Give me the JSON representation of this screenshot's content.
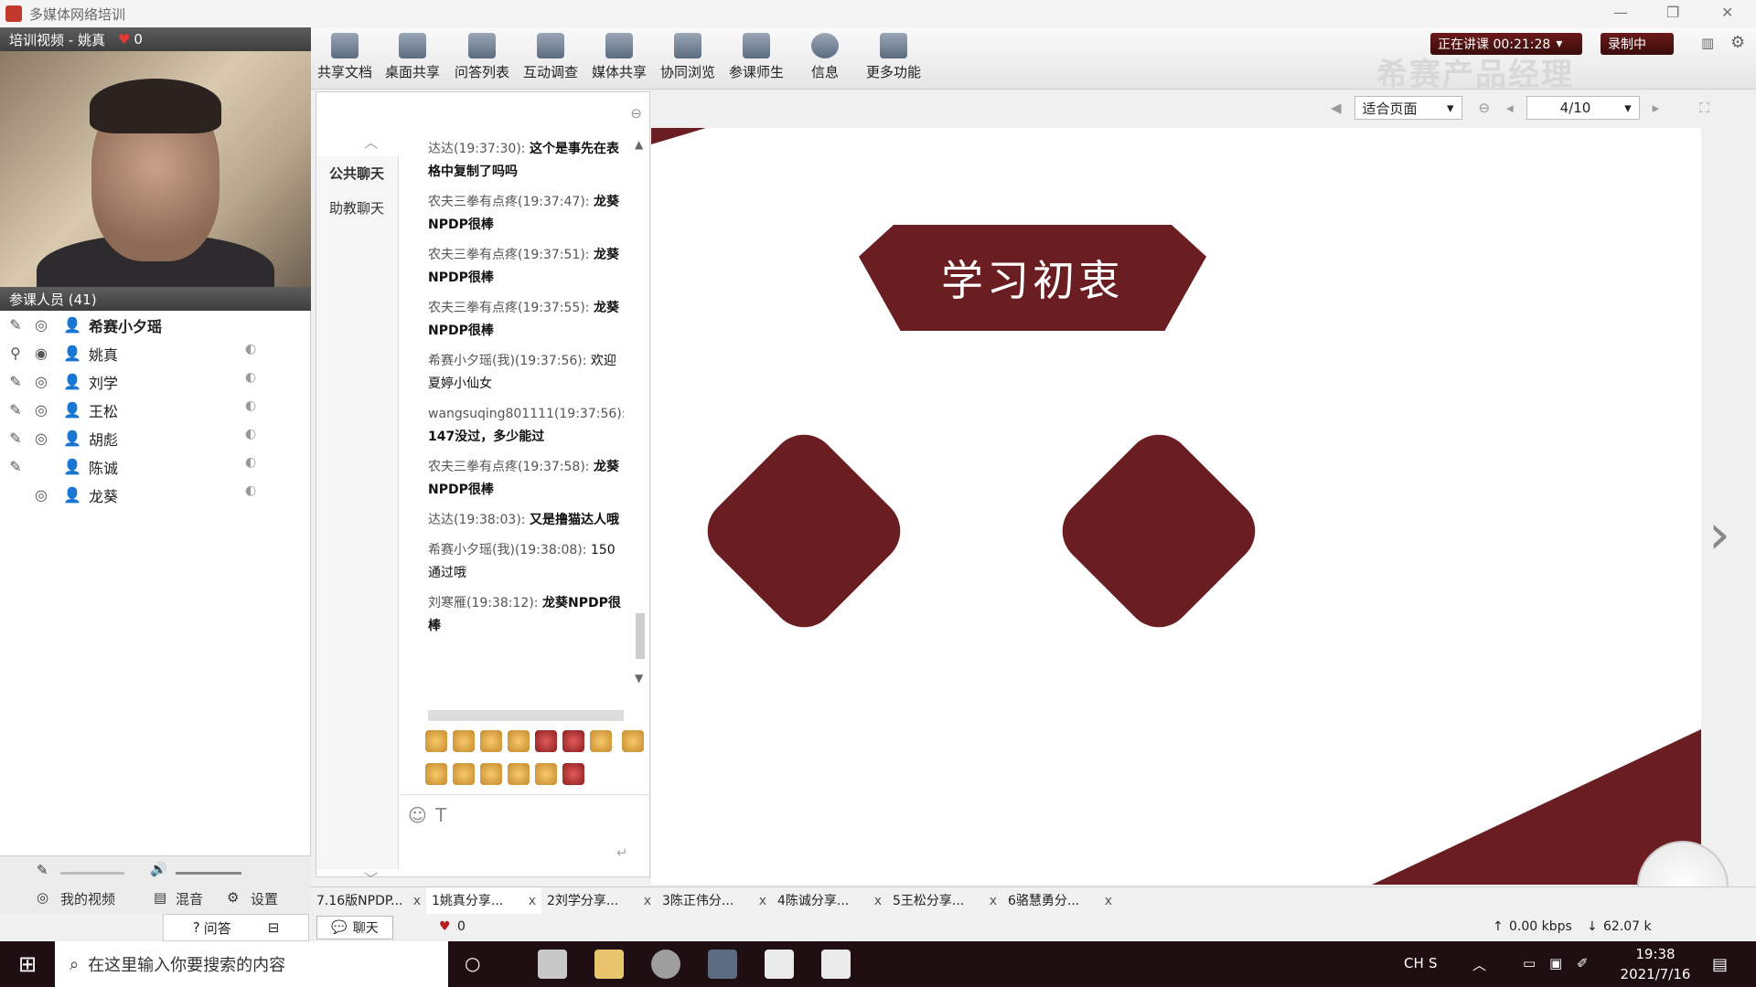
{
  "window": {
    "title": "多媒体网络培训"
  },
  "video": {
    "header": "培训视频 - 姚真",
    "likes": "0"
  },
  "members": {
    "header": "参课人员 (41)",
    "list": [
      {
        "name": "希赛小夕瑶"
      },
      {
        "name": "姚真"
      },
      {
        "name": "刘学"
      },
      {
        "name": "王松"
      },
      {
        "name": "胡彪"
      },
      {
        "name": "陈诚"
      },
      {
        "name": "龙葵"
      }
    ]
  },
  "left_bottom": {
    "my_video": "我的视频",
    "mix": "混音",
    "settings": "设置",
    "qa": "问答"
  },
  "toolbar": {
    "buttons": [
      "共享文档",
      "桌面共享",
      "问答列表",
      "互动调查",
      "媒体共享",
      "协同浏览",
      "参课师生",
      "信息",
      "更多功能"
    ],
    "live_status": "正在讲课 00:21:28",
    "record": "录制中",
    "brand_watermark": "希赛产品经理"
  },
  "docnav": {
    "fit": "适合页面",
    "page": "4/10"
  },
  "chat": {
    "tabs": [
      "公共聊天",
      "助教聊天"
    ],
    "messages": [
      {
        "who": "达达(19:37:30):",
        "text": "这个是事先在表格中复制了吗吗"
      },
      {
        "who": "农夫三拳有点疼(19:37:47):",
        "text": "龙葵NPDP很棒"
      },
      {
        "who": "农夫三拳有点疼(19:37:51):",
        "text": "龙葵NPDP很棒"
      },
      {
        "who": "农夫三拳有点疼(19:37:55):",
        "text": "龙葵NPDP很棒"
      },
      {
        "who": "希赛小夕瑶(我)(19:37:56):",
        "text": "欢迎夏婷小仙女"
      },
      {
        "who": "wangsuqing801111(19:37:56):",
        "text": "147没过，多少能过"
      },
      {
        "who": "农夫三拳有点疼(19:37:58):",
        "text": "龙葵NPDP很棒"
      },
      {
        "who": "达达(19:38:03):",
        "text": "又是撸猫达人哦"
      },
      {
        "who": "希赛小夕瑶(我)(19:38:08):",
        "text": "150通过哦"
      },
      {
        "who": "刘寒雁(19:38:12):",
        "text": "龙葵NPDP很棒"
      }
    ],
    "chat_button": "聊天",
    "likes": "0"
  },
  "slide": {
    "title": "学习初衷"
  },
  "files": [
    "7.16版NPDP...",
    "1姚真分享...",
    "2刘学分享...",
    "3陈正伟分...",
    "4陈诚分享...",
    "5王松分享...",
    "6骆慧勇分..."
  ],
  "network": {
    "up": "0.00 kbps",
    "down": "62.07 k"
  },
  "taskbar": {
    "search_placeholder": "在这里输入你要搜索的内容",
    "time": "19:38",
    "date": "2021/7/16",
    "lang": "CH"
  },
  "colors": {
    "accent": "#6b1e22",
    "taskbar": "#1f0f12"
  }
}
